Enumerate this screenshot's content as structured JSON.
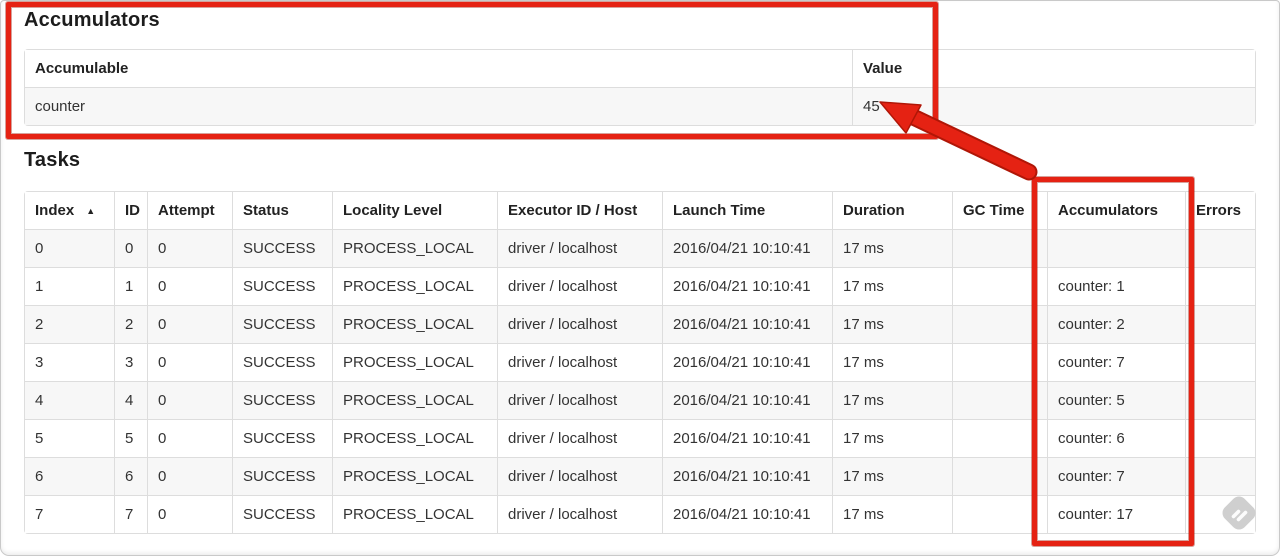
{
  "accumulators": {
    "title": "Accumulators",
    "table": {
      "headers": [
        "Accumulable",
        "Value"
      ],
      "rows": [
        {
          "accumulable": "counter",
          "value": "45"
        }
      ]
    }
  },
  "tasks": {
    "title": "Tasks",
    "table": {
      "headers": [
        "Index",
        "ID",
        "Attempt",
        "Status",
        "Locality Level",
        "Executor ID / Host",
        "Launch Time",
        "Duration",
        "GC Time",
        "Accumulators",
        "Errors"
      ],
      "sorted_column": "Index",
      "rows": [
        [
          "0",
          "0",
          "0",
          "SUCCESS",
          "PROCESS_LOCAL",
          "driver / localhost",
          "2016/04/21 10:10:41",
          "17 ms",
          "",
          "",
          ""
        ],
        [
          "1",
          "1",
          "0",
          "SUCCESS",
          "PROCESS_LOCAL",
          "driver / localhost",
          "2016/04/21 10:10:41",
          "17 ms",
          "",
          "counter: 1",
          ""
        ],
        [
          "2",
          "2",
          "0",
          "SUCCESS",
          "PROCESS_LOCAL",
          "driver / localhost",
          "2016/04/21 10:10:41",
          "17 ms",
          "",
          "counter: 2",
          ""
        ],
        [
          "3",
          "3",
          "0",
          "SUCCESS",
          "PROCESS_LOCAL",
          "driver / localhost",
          "2016/04/21 10:10:41",
          "17 ms",
          "",
          "counter: 7",
          ""
        ],
        [
          "4",
          "4",
          "0",
          "SUCCESS",
          "PROCESS_LOCAL",
          "driver / localhost",
          "2016/04/21 10:10:41",
          "17 ms",
          "",
          "counter: 5",
          ""
        ],
        [
          "5",
          "5",
          "0",
          "SUCCESS",
          "PROCESS_LOCAL",
          "driver / localhost",
          "2016/04/21 10:10:41",
          "17 ms",
          "",
          "counter: 6",
          ""
        ],
        [
          "6",
          "6",
          "0",
          "SUCCESS",
          "PROCESS_LOCAL",
          "driver / localhost",
          "2016/04/21 10:10:41",
          "17 ms",
          "",
          "counter: 7",
          ""
        ],
        [
          "7",
          "7",
          "0",
          "SUCCESS",
          "PROCESS_LOCAL",
          "driver / localhost",
          "2016/04/21 10:10:41",
          "17 ms",
          "",
          "counter: 17",
          ""
        ]
      ]
    }
  },
  "icons": {
    "sort_ascending": "▲",
    "watermark": "feedly-diamond-logo"
  },
  "annotations": {
    "highlight_color": "#e52213",
    "boxes": [
      "accumulators-section",
      "tasks-accumulators-column"
    ],
    "arrow": "points-from-accumulators-column-to-value-45"
  }
}
